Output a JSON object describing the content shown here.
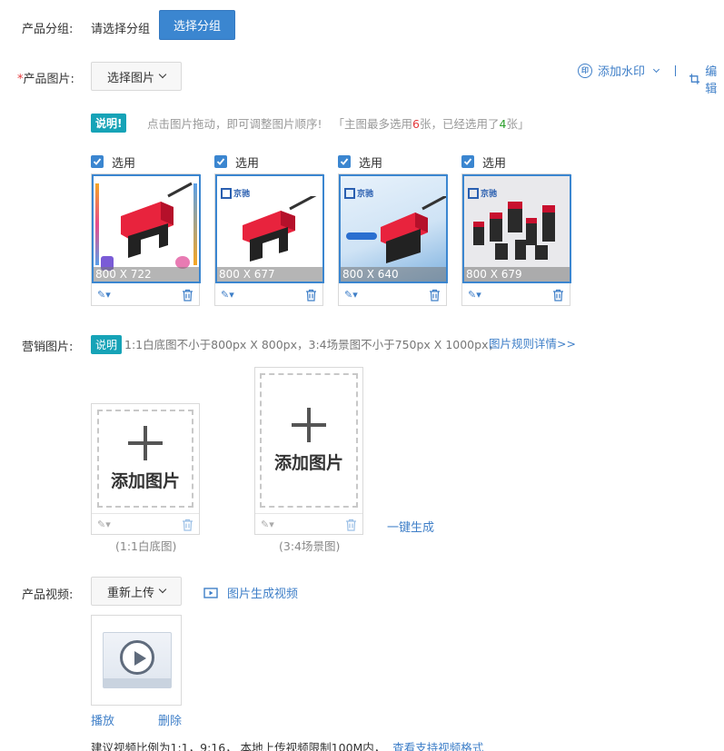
{
  "group": {
    "label": "产品分组:",
    "placeholder_text": "请选择分组",
    "select_button": "选择分组"
  },
  "images": {
    "required_mark": "*",
    "label": "产品图片:",
    "select_button": "选择图片",
    "watermark_label": "添加水印",
    "edit_label": "编辑",
    "tip_badge": "说明!",
    "tip_text_a": "点击图片拖动，即可调整图片顺序!",
    "tip_text_b": "「主图最多选用",
    "tip_max": "6",
    "tip_text_c": "张，已经选用了",
    "tip_used": "4",
    "tip_text_d": "张」",
    "thumbs": [
      {
        "select_label": "选用",
        "dims": "800 X 722",
        "brand": ""
      },
      {
        "select_label": "选用",
        "dims": "800 X 677",
        "brand": "京驰"
      },
      {
        "select_label": "选用",
        "dims": "800 X 640",
        "brand": "京驰"
      },
      {
        "select_label": "选用",
        "dims": "800 X 679",
        "brand": "京驰"
      }
    ]
  },
  "marketing": {
    "label": "营销图片:",
    "tip_badge": "说明",
    "tip_text": "1:1白底图不小于800px X 800px，3:4场景图不小于750px X 1000px，",
    "rules_link": "图片规则详情>>",
    "slots": [
      {
        "add_text": "添加图片",
        "caption": "(1:1白底图)"
      },
      {
        "add_text": "添加图片",
        "caption": "(3:4场景图)"
      }
    ],
    "generate_link": "一键生成"
  },
  "video": {
    "label": "产品视频:",
    "reupload_button": "重新上传",
    "generate_link": "图片生成视频",
    "play_link": "播放",
    "delete_link": "删除",
    "note_text": "建议视频比例为1:1，9:16， 本地上传视频限制100M内，",
    "formats_link": "查看支持视频格式"
  },
  "colors": {
    "accent": "#3b86d0",
    "link": "#3f7fc8",
    "badge": "#16a3b7",
    "warn": "#e4393c",
    "ok": "#2ca02c"
  }
}
